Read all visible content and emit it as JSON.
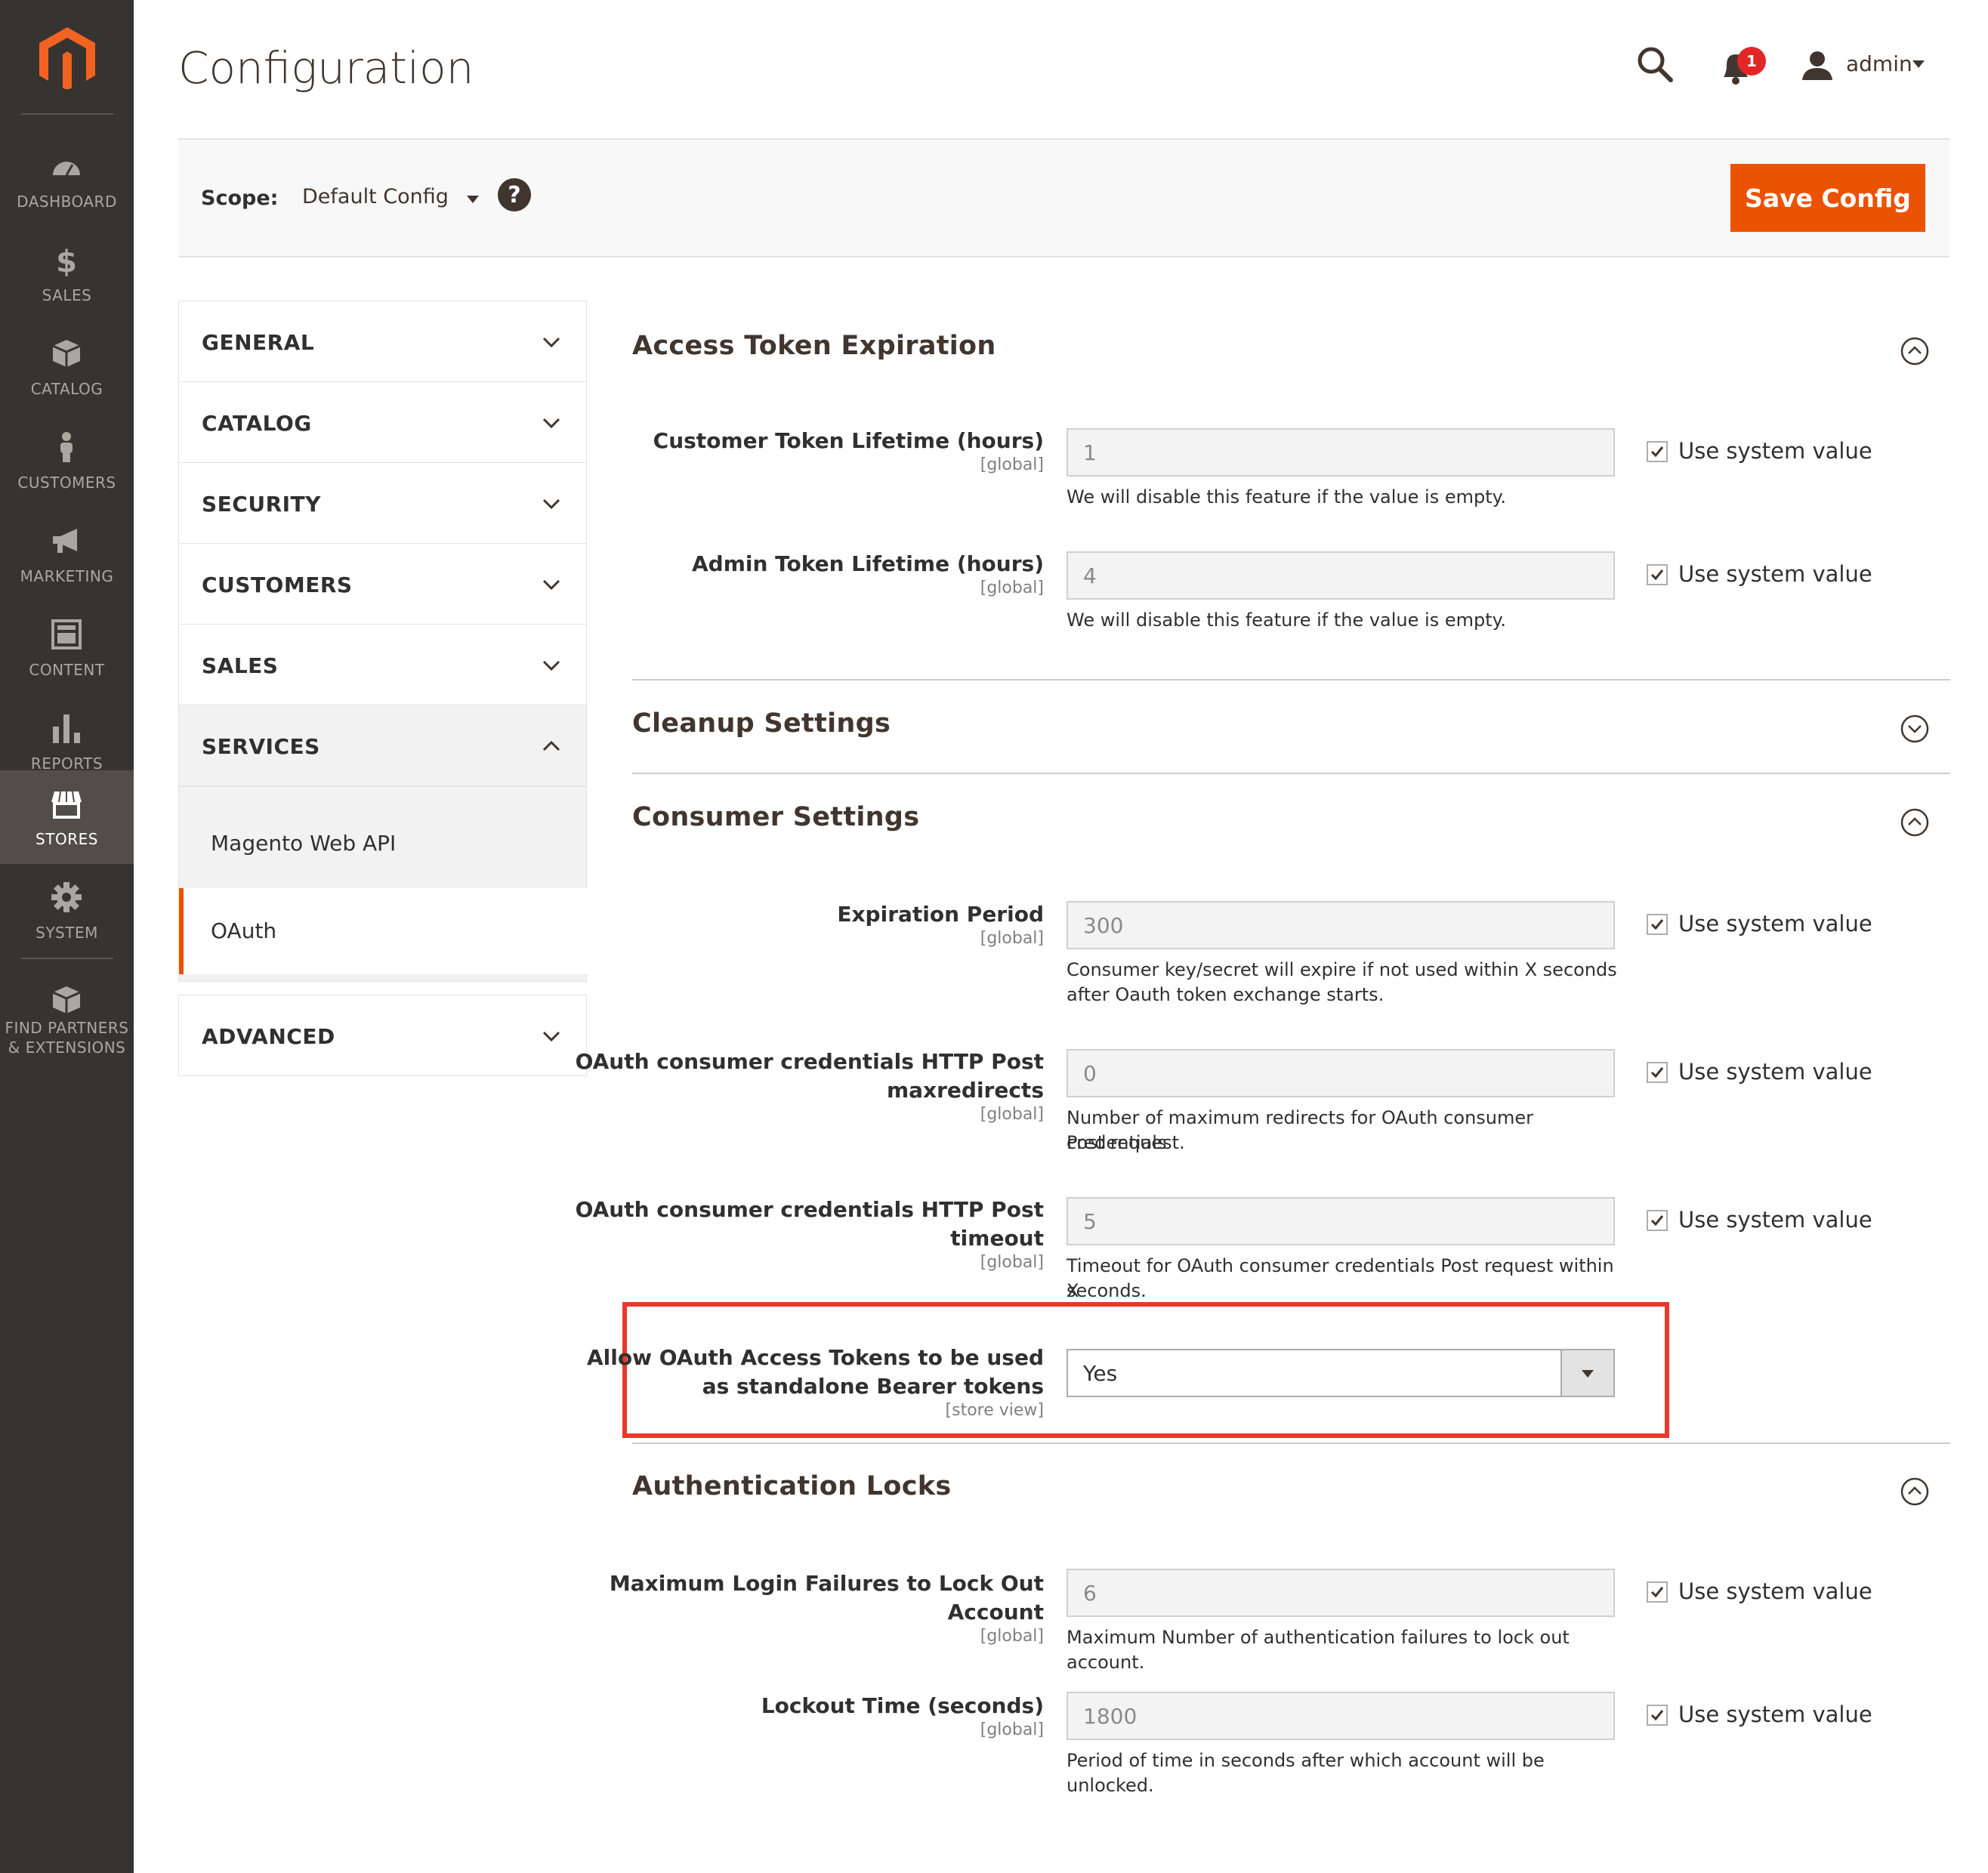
{
  "nav": {
    "items": [
      {
        "label": "DASHBOARD",
        "icon": "dashboard-icon"
      },
      {
        "label": "SALES",
        "icon": "dollar-icon"
      },
      {
        "label": "CATALOG",
        "icon": "box-icon"
      },
      {
        "label": "CUSTOMERS",
        "icon": "person-icon"
      },
      {
        "label": "MARKETING",
        "icon": "megaphone-icon"
      },
      {
        "label": "CONTENT",
        "icon": "layout-icon"
      },
      {
        "label": "REPORTS",
        "icon": "bar-chart-icon"
      },
      {
        "label": "STORES",
        "icon": "store-icon"
      },
      {
        "label": "SYSTEM",
        "icon": "gear-icon"
      },
      {
        "label1": "FIND PARTNERS",
        "label2": "& EXTENSIONS",
        "icon": "extensions-icon"
      }
    ],
    "active": "STORES"
  },
  "header": {
    "title": "Configuration",
    "notification_count": "1",
    "user": "admin"
  },
  "scope": {
    "label": "Scope:",
    "value": "Default Config",
    "save_label": "Save Config"
  },
  "menu": {
    "sections": [
      "GENERAL",
      "CATALOG",
      "SECURITY",
      "CUSTOMERS",
      "SALES",
      "SERVICES",
      "ADVANCED"
    ],
    "expanded": "SERVICES",
    "subitems": [
      "Magento Web API",
      "OAuth"
    ],
    "active_subitem": "OAuth"
  },
  "content": {
    "sections": {
      "access_token": "Access Token Expiration",
      "cleanup": "Cleanup Settings",
      "consumer": "Consumer Settings",
      "auth_locks": "Authentication Locks"
    },
    "use_system_value": "Use system value",
    "fields": {
      "customer_token": {
        "label": "Customer Token Lifetime (hours)",
        "scope": "[global]",
        "value": "1",
        "note": "We will disable this feature if the value is empty."
      },
      "admin_token": {
        "label": "Admin Token Lifetime (hours)",
        "scope": "[global]",
        "value": "4",
        "note": "We will disable this feature if the value is empty."
      },
      "expiration_period": {
        "label": "Expiration Period",
        "scope": "[global]",
        "value": "300",
        "note1": "Consumer key/secret will expire if not used within X seconds",
        "note2": "after Oauth token exchange starts."
      },
      "maxredirects": {
        "label1": "OAuth consumer credentials HTTP Post",
        "label2": "maxredirects",
        "scope": "[global]",
        "value": "0",
        "note1": "Number of maximum redirects for OAuth consumer credentials",
        "note2": "Post request."
      },
      "timeout": {
        "label1": "OAuth consumer credentials HTTP Post",
        "label2": "timeout",
        "scope": "[global]",
        "value": "5",
        "note1": "Timeout for OAuth consumer credentials Post request within X",
        "note2": "seconds."
      },
      "bearer": {
        "label1": "Allow OAuth Access Tokens to be used",
        "label2": "as standalone Bearer tokens",
        "scope": "[store view]",
        "value": "Yes"
      },
      "max_failures": {
        "label1": "Maximum Login Failures to Lock Out",
        "label2": "Account",
        "scope": "[global]",
        "value": "6",
        "note": "Maximum Number of authentication failures to lock out account."
      },
      "lockout_time": {
        "label": "Lockout Time (seconds)",
        "scope": "[global]",
        "value": "1800",
        "note": "Period of time in seconds after which account will be unlocked."
      }
    }
  },
  "colors": {
    "nav_bg": "#373330",
    "nav_active": "#524d49",
    "accent": "#eb5202",
    "highlight": "#e8392a",
    "badge": "#e22626"
  }
}
